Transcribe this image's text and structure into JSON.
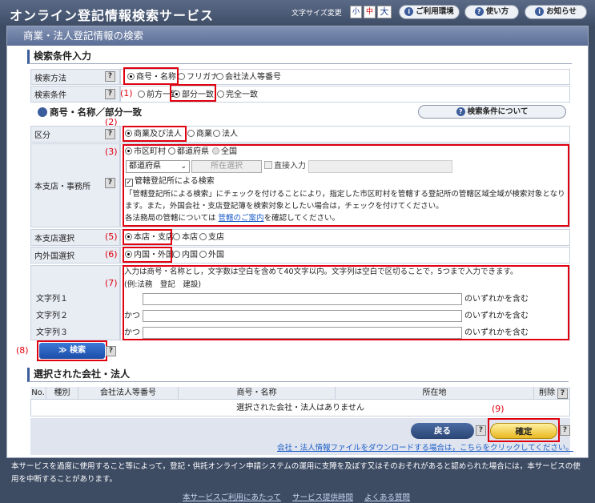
{
  "header": {
    "title": "オンライン登記情報検索サービス",
    "font_size_label": "文字サイズ変更",
    "font_sizes": [
      "小",
      "中",
      "大"
    ],
    "env_label": "ご利用環境",
    "howto_label": "使い方",
    "news_label": "お知らせ"
  },
  "page_title": "商業・法人登記情報の検索",
  "search_section": "検索条件入力",
  "method": {
    "label": "検索方法",
    "options": [
      "商号・名称",
      "フリガナ",
      "会社法人等番号"
    ],
    "selected": "商号・名称"
  },
  "condition": {
    "label": "検索条件",
    "options": [
      "前方一致",
      "部分一致",
      "完全一致"
    ],
    "selected": "部分一致"
  },
  "match_heading": "商号・名称／部分一致",
  "about_button": "検索条件について",
  "kubun": {
    "label": "区分",
    "options": [
      "商業及び法人",
      "商業",
      "法人"
    ],
    "selected": "商業及び法人"
  },
  "office": {
    "label": "本支店・事務所",
    "options": [
      "市区町村",
      "都道府県",
      "全国"
    ],
    "selected": "市区町村",
    "pref_select": "都道府県",
    "location_button": "所在選択",
    "direct_label": "直接入力",
    "check_label": "管轄登記所による検索",
    "note1": "「管轄登記所による検索」にチェックを付けることにより，指定した市区町村を管轄する登記所の管轄区域全域が検索対象となり",
    "note2": "ます。また，外国会社・支店登記簿を検索対象としたい場合は，チェックを付けてください。",
    "note3_pre": "各法務局の管轄については ",
    "note3_link": "管轄のご案内",
    "note3_post": "を確認してください。"
  },
  "branch": {
    "label": "本支店選択",
    "options": [
      "本店・支店",
      "本店",
      "支店"
    ],
    "selected": "本店・支店"
  },
  "domestic": {
    "label": "内外国選択",
    "options": [
      "内国・外国",
      "内国",
      "外国"
    ],
    "selected": "内国・外国"
  },
  "strings": {
    "note1": "入力は商号・名称とし，文字数は空白を含めて40文字以内。文字列は空白で区切ることで，5つまで入力できます。",
    "note2": "(例:法務　登記　建設)",
    "labels": [
      "文字列１",
      "文字列２",
      "文字列３"
    ],
    "conj": "かつ",
    "suffix": "のいずれかを含む",
    "values": [
      "",
      "",
      ""
    ]
  },
  "markers": [
    "(1)",
    "(2)",
    "(3)",
    "(5)",
    "(6)",
    "(7)",
    "(8)",
    "(9)"
  ],
  "search_button": "≫ 検索",
  "selected_section": "選択された会社・法人",
  "table": {
    "headers": [
      "No.",
      "種別",
      "会社法人等番号",
      "商号・名称",
      "所在地",
      "削除"
    ],
    "empty": "選択された会社・法人はありません"
  },
  "back_button": "戻る",
  "ok_button": "確定",
  "download_link": "会社・法人情報ファイルをダウンロードする場合は，こちらをクリックしてください。",
  "footer": {
    "text": "本サービスを過度に使用すること等によって，登記・供託オンライン申請システムの運用に支障を及ぼす又はそのおそれがあると認められた場合には，本サービスの使用を中断することがあります。",
    "links": [
      "本サービスご利用にあたって",
      "サービス提供時間",
      "よくある質問"
    ]
  },
  "colors": {
    "accent": "#3c5d9c",
    "highlight": "#e00010",
    "confirm": "#e8b820"
  }
}
